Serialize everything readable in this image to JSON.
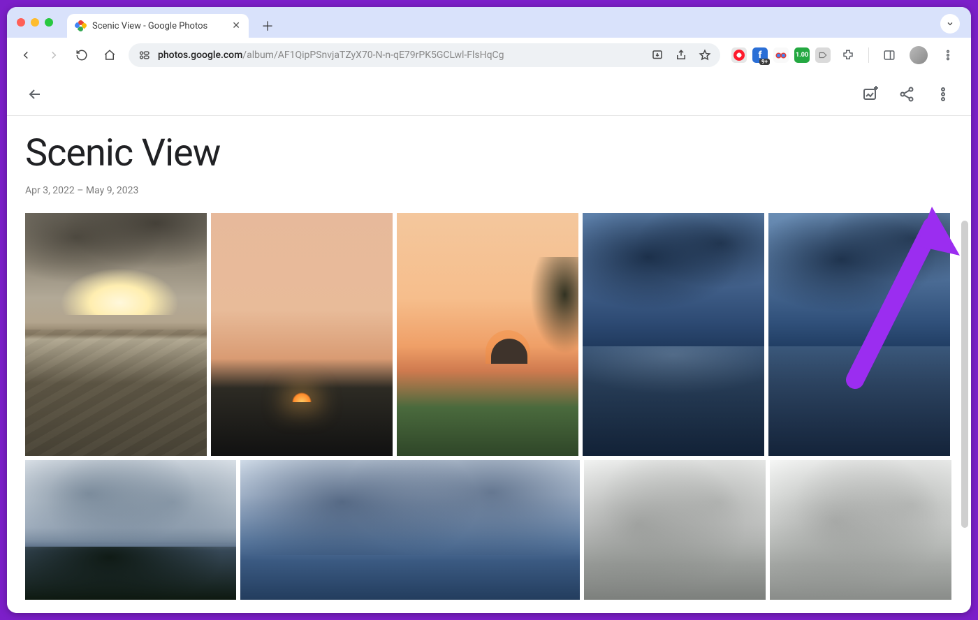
{
  "browser": {
    "tab": {
      "title": "Scenic View - Google Photos"
    },
    "url_host": "photos.google.com",
    "url_path": "/album/AF1QipPSnvjaTZyX70-N-n-qE79rPK5GCLwl-FlsHqCg",
    "extension_badge": "9+",
    "extension_green": "1.00"
  },
  "app": {
    "back_label": "Back",
    "add_photos_label": "Add photos",
    "share_label": "Share",
    "more_label": "More options"
  },
  "album": {
    "title": "Scenic View",
    "date_range": "Apr 3, 2022 – May 9, 2023",
    "photo_count_row1": 5,
    "photo_count_row2": 4
  },
  "annotation": {
    "target": "more-options-button"
  }
}
